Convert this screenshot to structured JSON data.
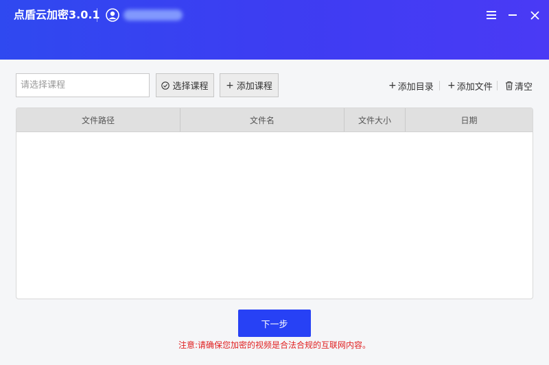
{
  "app": {
    "title": "点盾云加密3.0.1"
  },
  "icons": {
    "user": "user-avatar-icon",
    "menu": "hamburger-menu-icon",
    "minimize": "minimize-icon",
    "close": "close-icon",
    "check": "check-circle-icon",
    "trash": "trash-icon"
  },
  "colors": {
    "header_gradient_start": "#2f49f0",
    "header_gradient_end": "#4a3af5",
    "primary_button": "#2741f5",
    "notice_text": "#e02020"
  },
  "toolbar": {
    "course_input_placeholder": "请选择课程",
    "course_input_value": "",
    "select_course_label": "选择课程",
    "add_course_label": "添加课程",
    "add_dir_label": "添加目录",
    "add_file_label": "添加文件",
    "clear_label": "清空",
    "plus_glyph": "+"
  },
  "table": {
    "columns": [
      "文件路径",
      "文件名",
      "文件大小",
      "日期"
    ],
    "rows": []
  },
  "footer": {
    "next_label": "下一步",
    "notice": "注意:请确保您加密的视频是合法合规的互联网内容。"
  }
}
